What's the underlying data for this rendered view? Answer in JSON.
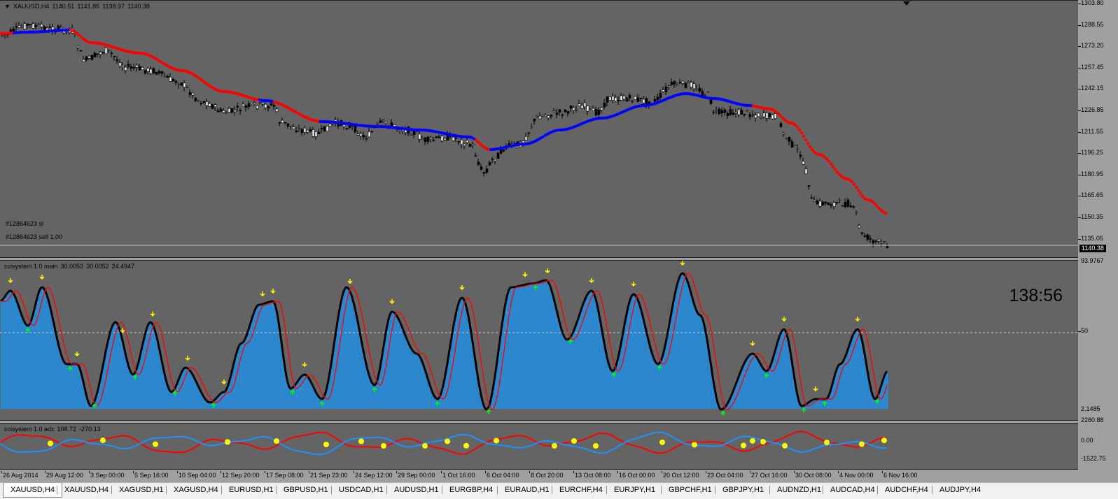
{
  "symbol_header": {
    "symbol": "XAUUSD,H4",
    "open": "1140.51",
    "high": "1141.86",
    "low": "1138.97",
    "close": "1140.38"
  },
  "trade_labels": {
    "sl": "#12864623 sl",
    "sell": "#12864623 sell 1.00"
  },
  "price_scale": [
    "1303.80",
    "1288.55",
    "1273.20",
    "1257.45",
    "1242.15",
    "1226.85",
    "1211.55",
    "1196.25",
    "1180.95",
    "1165.65",
    "1150.35",
    "1135.05"
  ],
  "current_price": "1140.38",
  "cci_header": {
    "name": "ccisystem 1.0 main",
    "v1": "30.0052",
    "v2": "30.0052",
    "v3": "24.4947"
  },
  "cci_scale": {
    "top": "93.9767",
    "mid": "50",
    "bottom": "2.1485"
  },
  "timer": "138:56",
  "adx_header": {
    "name": "ccisystem 1.0 adx",
    "v1": "108.72",
    "v2": "-270.13"
  },
  "adx_scale": {
    "top": "2280.88",
    "mid": "0.00",
    "bottom": "-1522.75"
  },
  "time_axis": [
    "26 Aug 2014",
    "29 Aug 12:00",
    "3 Sep 00:00",
    "5 Sep 16:00",
    "10 Sep 04:00",
    "12 Sep 20:00",
    "17 Sep 08:00",
    "21 Sep 23:00",
    "24 Sep 12:00",
    "29 Sep 00:00",
    "1 Oct 16:00",
    "6 Oct 04:00",
    "8 Oct 20:00",
    "13 Oct 08:00",
    "16 Oct 00:00",
    "20 Oct 12:00",
    "23 Oct 04:00",
    "27 Oct 16:00",
    "30 Oct 08:00",
    "4 Nov 00:00",
    "6 Nov 16:00"
  ],
  "tabs": [
    "XAUUSD,H4",
    "XAUUSD,H4",
    "XAGUSD,H1",
    "XAGUSD,H4",
    "EURUSD,H1",
    "GBPUSD,H1",
    "USDCAD,H1",
    "AUDUSD,H1",
    "EURGBP,H4",
    "EURAUD,H1",
    "EURCHF,H4",
    "EURJPY,H1",
    "GBPCHF,H1",
    "GBPJPY,H1",
    "AUDNZD,H1",
    "AUDCAD,H4",
    "AUDCHF,H4",
    "AUDJPY,H4"
  ],
  "active_tab": 0,
  "colors": {
    "pane_bg": "#646464",
    "scale_bg": "#a0a0a0",
    "trend_down": "#ff0000",
    "trend_up": "#0000ff",
    "histogram": "#1e8fe6",
    "cci_main": "#000000",
    "cci_signal": "#ff0000",
    "arrow_sell": "#ffff00",
    "arrow_buy": "#00ff00",
    "adx_red": "#ff0000",
    "adx_blue": "#1e90ff",
    "adx_dot": "#ffff00"
  }
}
